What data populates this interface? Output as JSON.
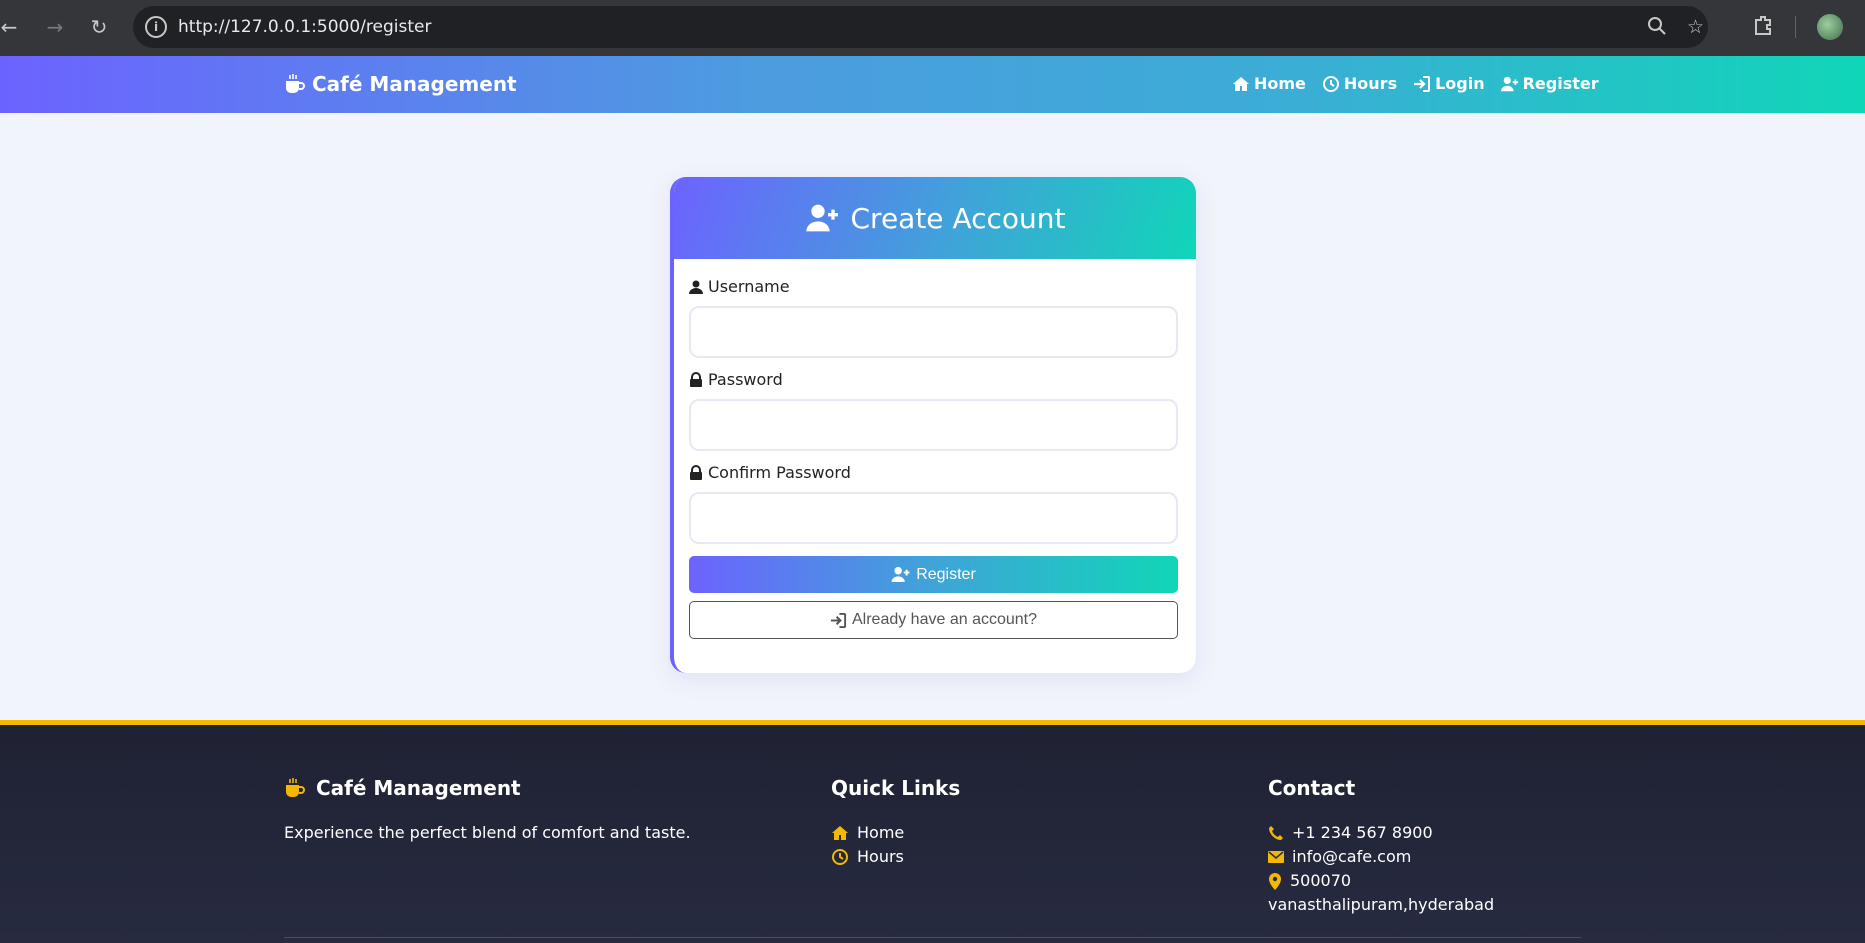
{
  "browser": {
    "url": "http://127.0.0.1:5000/register"
  },
  "navbar": {
    "brand": "Café Management",
    "links": [
      {
        "label": "Home",
        "icon": "home-icon"
      },
      {
        "label": "Hours",
        "icon": "clock-icon"
      },
      {
        "label": "Login",
        "icon": "login-icon"
      },
      {
        "label": "Register",
        "icon": "user-plus-icon"
      }
    ]
  },
  "form": {
    "title": "Create Account",
    "username_label": "Username",
    "password_label": "Password",
    "confirm_label": "Confirm Password",
    "username_value": "",
    "password_value": "",
    "confirm_value": "",
    "register_label": "Register",
    "login_label": "Already have an account?"
  },
  "footer": {
    "brand": "Café Management",
    "tagline": "Experience the perfect blend of comfort and taste.",
    "quick_links_title": "Quick Links",
    "quick_links": [
      {
        "label": "Home",
        "icon": "home-icon"
      },
      {
        "label": "Hours",
        "icon": "clock-icon"
      }
    ],
    "contact_title": "Contact",
    "contact": {
      "phone": "+1 234 567 8900",
      "email": "info@cafe.com",
      "pin": "500070",
      "address": "vanasthalipuram,hyderabad"
    }
  },
  "colors": {
    "accent_start": "#6c63ff",
    "accent_end": "#10d6b8",
    "footer_accent": "#f5b800",
    "footer_bg": "#1f2233"
  }
}
